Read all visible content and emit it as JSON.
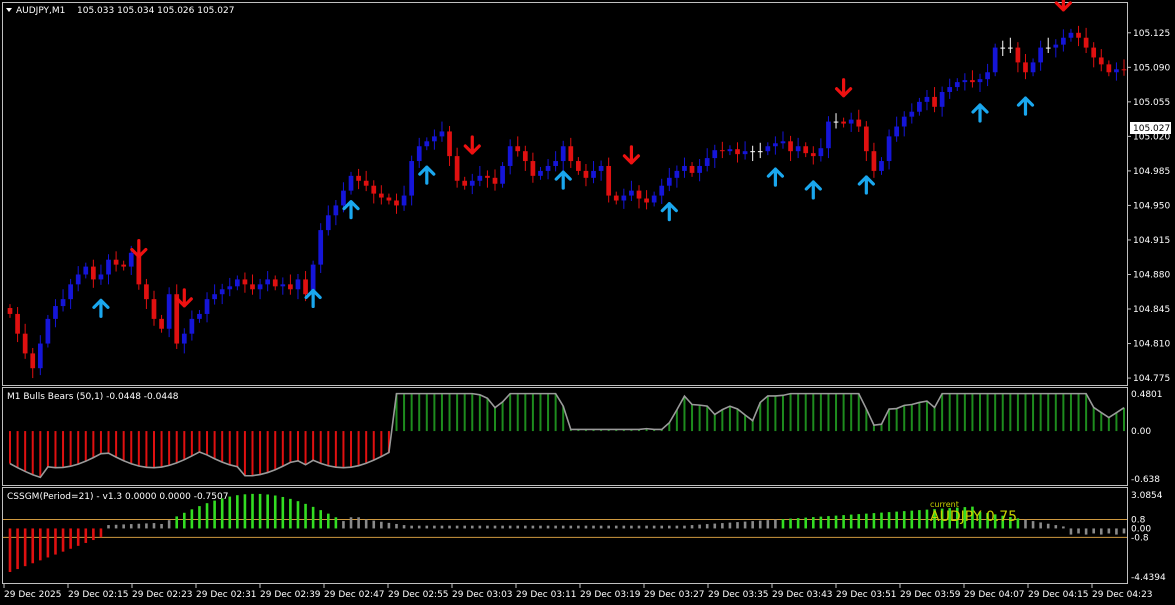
{
  "colors": {
    "bull": "#1515d8",
    "bear": "#e01010",
    "up_arrow": "#1aa7ee",
    "down_arrow": "#ee1111",
    "hist_green": "#1e8c1e",
    "hist_red": "#e01010",
    "line": "#9a9a9a",
    "bright_green": "#33dd22",
    "gray": "#8a8a8a",
    "orange": "#d09a40",
    "frame": "#c0c0c0"
  },
  "header": {
    "symbol_tf": "AUDJPY,M1",
    "ohlc": "105.033 105.034 105.026 105.027"
  },
  "price_axis": {
    "ticks": [
      "105.125",
      "105.090",
      "105.055",
      "105.020",
      "104.985",
      "104.950",
      "104.915",
      "104.880",
      "104.845",
      "104.810",
      "104.775"
    ],
    "current": "105.027"
  },
  "time_axis": [
    "29 Dec 2025",
    "29 Dec 02:15",
    "29 Dec 02:23",
    "29 Dec 02:31",
    "29 Dec 02:39",
    "29 Dec 02:47",
    "29 Dec 02:55",
    "29 Dec 03:03",
    "29 Dec 03:11",
    "29 Dec 03:19",
    "29 Dec 03:27",
    "29 Dec 03:35",
    "29 Dec 03:43",
    "29 Dec 03:51",
    "29 Dec 03:59",
    "29 Dec 04:07",
    "29 Dec 04:15",
    "29 Dec 04:23"
  ],
  "indicator1": {
    "title": "M1 Bulls Bears (50,1) -0.0448 -0.0448",
    "ticks": [
      "0.4801",
      "0.00",
      "-0.638"
    ]
  },
  "indicator2": {
    "title": "CSSGM(Period=21) - v1.3 0.0000 0.0000 -0.7507",
    "ticks": [
      "3.0854",
      "0.8",
      "0.00",
      "-0.8",
      "-4.4394"
    ],
    "overlay_small": "current",
    "overlay_big": "AUDJPY  0.75"
  },
  "chart_data": [
    {
      "type": "candlestick",
      "symbol": "AUDJPY",
      "timeframe": "M1",
      "y_ticks": [
        104.775,
        104.81,
        104.845,
        104.88,
        104.915,
        104.95,
        104.985,
        105.02,
        105.055,
        105.09,
        105.125
      ],
      "ylim": [
        104.77,
        105.14
      ],
      "close": [
        104.84,
        104.82,
        104.8,
        104.785,
        104.81,
        104.835,
        104.848,
        104.855,
        104.87,
        104.88,
        104.888,
        104.875,
        104.88,
        104.895,
        104.89,
        104.888,
        104.902,
        104.87,
        104.855,
        104.835,
        104.825,
        104.86,
        104.81,
        104.82,
        104.835,
        104.84,
        104.855,
        104.86,
        104.865,
        104.868,
        104.875,
        104.87,
        104.865,
        104.87,
        104.875,
        104.868,
        104.87,
        104.865,
        104.875,
        104.86,
        104.89,
        104.925,
        104.94,
        104.95,
        104.965,
        104.98,
        104.975,
        104.97,
        104.962,
        104.958,
        104.955,
        104.95,
        104.96,
        104.995,
        105.01,
        105.015,
        105.02,
        105.025,
        105.0,
        104.975,
        104.97,
        104.975,
        104.98,
        104.978,
        104.972,
        104.99,
        105.01,
        105.005,
        104.995,
        104.98,
        104.985,
        104.99,
        104.995,
        105.01,
        104.995,
        104.985,
        104.978,
        104.985,
        104.99,
        104.96,
        104.955,
        104.96,
        104.965,
        104.957,
        104.953,
        104.96,
        104.97,
        104.978,
        104.985,
        104.99,
        104.983,
        104.99,
        104.998,
        105.006,
        105.005,
        105.007,
        105.002,
        105.005,
        105.005,
        105.005,
        105.01,
        105.013,
        105.015,
        105.005,
        105.01,
        105.003,
        105.0,
        105.008,
        105.035,
        105.035,
        105.033,
        105.037,
        105.03,
        105.005,
        104.985,
        104.995,
        105.02,
        105.03,
        105.04,
        105.045,
        105.055,
        105.06,
        105.05,
        105.065,
        105.07,
        105.075,
        105.077,
        105.075,
        105.078,
        105.085,
        105.11,
        105.11,
        105.11,
        105.095,
        105.085,
        105.095,
        105.11,
        105.11,
        105.113,
        105.12,
        105.125,
        105.12,
        105.11,
        105.1,
        105.093,
        105.085,
        105.088,
        105.087
      ],
      "buy_arrow_bars": [
        12,
        40,
        45,
        55,
        73,
        87,
        101,
        106,
        113,
        128,
        134
      ],
      "sell_arrow_bars": [
        17,
        23,
        61,
        82,
        110,
        139
      ]
    },
    {
      "type": "histogram",
      "name": "M1 Bulls Bears (50,1)",
      "ylim": [
        -0.638,
        0.4801
      ],
      "values_in_price_pane_units_source": "derived",
      "note_hidden": false
    },
    {
      "type": "histogram",
      "name": "CSSGM(Period=21)",
      "ylim": [
        -4.4394,
        3.0854
      ],
      "levels": [
        0.8,
        0.0,
        -0.8
      ]
    }
  ]
}
